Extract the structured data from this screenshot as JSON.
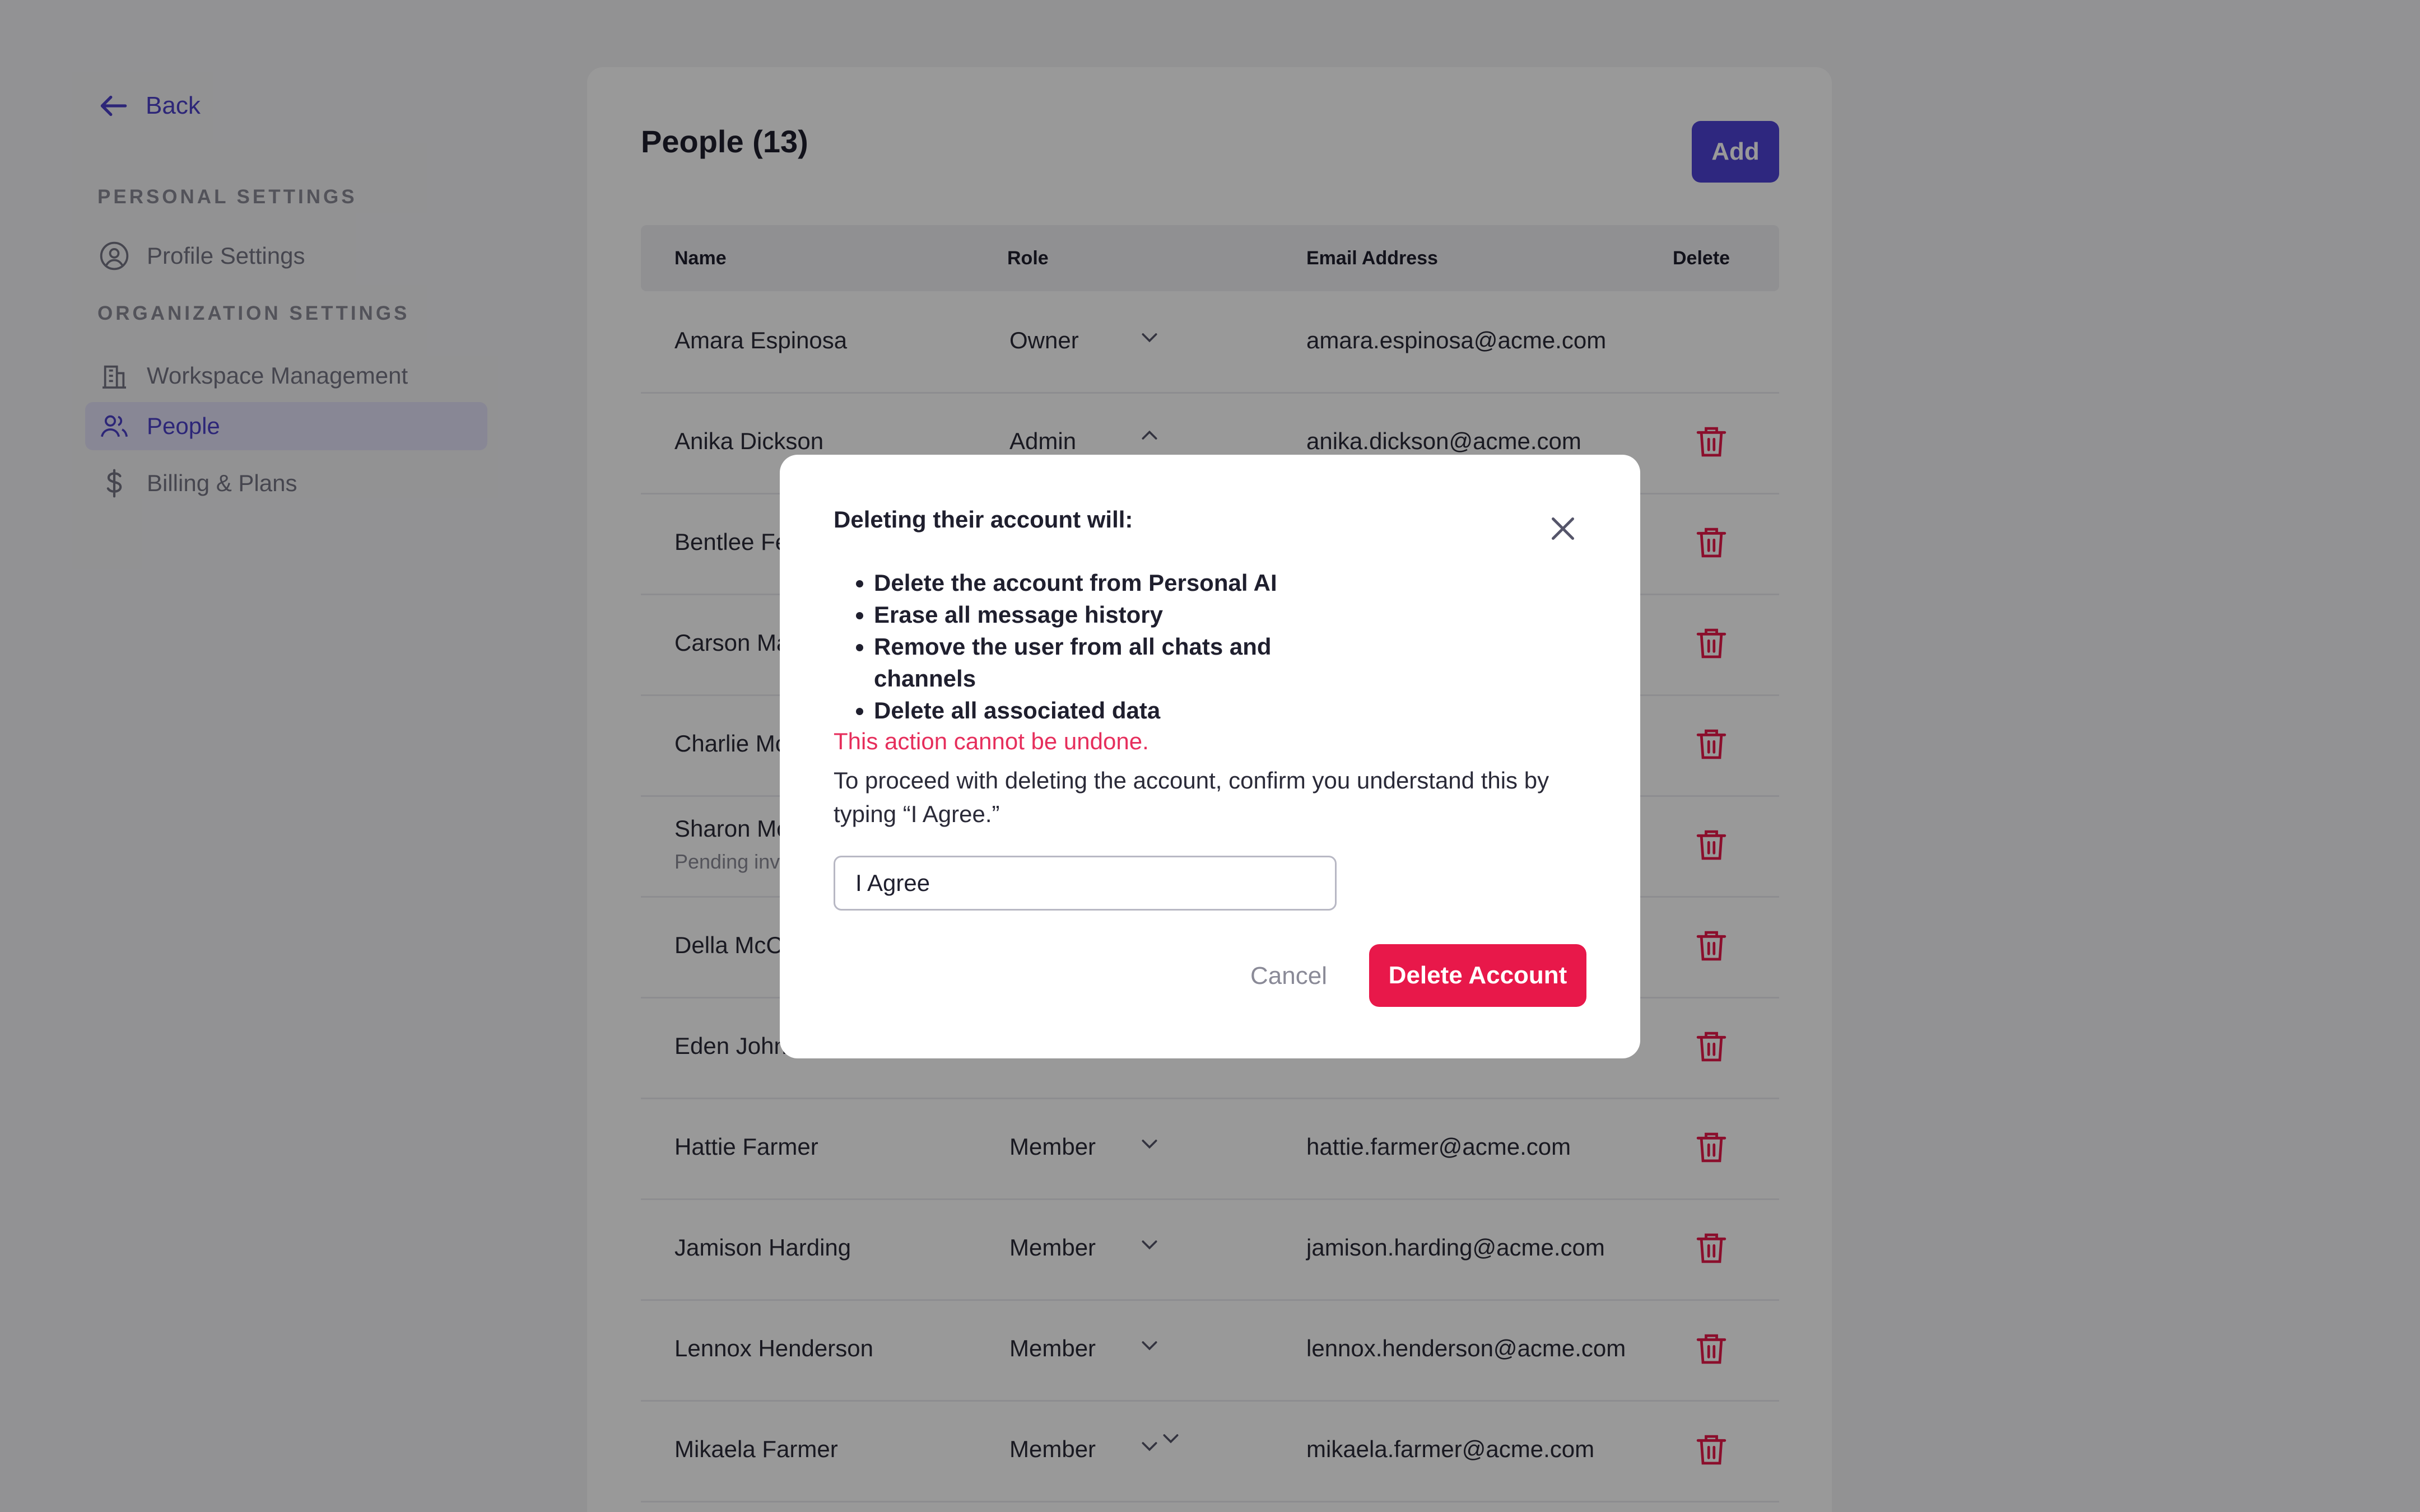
{
  "sidebar": {
    "back_label": "Back",
    "personal_section": "PERSONAL SETTINGS",
    "org_section": "ORGANIZATION SETTINGS",
    "items": [
      {
        "label": "Profile Settings",
        "icon": "user-circle-icon"
      },
      {
        "label": "Workspace Management",
        "icon": "building-icon"
      },
      {
        "label": "People",
        "icon": "users-icon",
        "active": true
      },
      {
        "label": "Billing & Plans",
        "icon": "dollar-icon"
      }
    ]
  },
  "main": {
    "title": "People (13)",
    "add_label": "Add",
    "columns": {
      "name": "Name",
      "role": "Role",
      "email": "Email Address",
      "delete": "Delete"
    },
    "rows": [
      {
        "name": "Amara Espinosa",
        "role": "Owner",
        "email": "amara.espinosa@acme.com"
      },
      {
        "name": "Anika Dickson",
        "role": "Admin",
        "email": "anika.dickson@acme.com"
      },
      {
        "name": "Bentlee Fe"
      },
      {
        "name": "Carson Ma"
      },
      {
        "name": "Charlie Mc"
      },
      {
        "name": "Sharon Mc",
        "status": "Pending inv"
      },
      {
        "name": "Della McC"
      },
      {
        "name": "Eden John"
      },
      {
        "name": "Hattie Farmer",
        "role": "Member",
        "email": "hattie.farmer@acme.com"
      },
      {
        "name": "Jamison Harding",
        "role": "Member",
        "email": "jamison.harding@acme.com"
      },
      {
        "name": "Lennox Henderson",
        "role": "Member",
        "email": "lennox.henderson@acme.com"
      },
      {
        "name": "Mikaela Farmer",
        "role": "Member",
        "email": "mikaela.farmer@acme.com"
      }
    ]
  },
  "modal": {
    "title": "Deleting their account will:",
    "consequences": [
      "Delete the account from Personal AI",
      "Erase all message history",
      "Remove the user from all chats and channels",
      "Delete all associated data"
    ],
    "warning": "This action cannot be undone.",
    "instruction": "To proceed with deleting the account, confirm you understand this by typing “I Agree.”",
    "input_value": "I Agree",
    "cancel_label": "Cancel",
    "delete_label": "Delete Account"
  },
  "colors": {
    "accent": "#4e42d4",
    "danger": "#e8184a",
    "warning_text": "#e62e5c",
    "overlay": "rgba(0,0,0,0.4)"
  }
}
